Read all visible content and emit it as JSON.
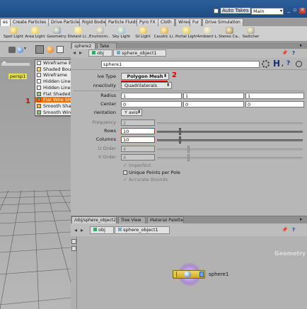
{
  "titlebar": {
    "auto_takes_label": "Auto Takes",
    "takes_select_value": "Main",
    "window_controls": [
      "minimize-icon",
      "maximize-icon",
      "close-icon"
    ]
  },
  "shelf": {
    "tabs": [
      "es",
      "Create Particles",
      "Drive Particles",
      "Rigid Bodies",
      "Particle Fluids",
      "Pyro FX",
      "Cloth",
      "Wires",
      "Fur",
      "Drive Simulation"
    ],
    "tools": [
      "Spot Light",
      "Area Light",
      "Geometry",
      "Distant Li...",
      "Environm...",
      "Sky Light",
      "GI Light",
      "Caustic Li...",
      "Portal Light",
      "Ambient L...",
      "Stereo Ca...",
      "Switcher"
    ]
  },
  "viewport": {
    "object_label": "persp1"
  },
  "shading_menu": {
    "items": [
      "Wireframe Bounding Box",
      "Shaded Bounding Box",
      "Wireframe",
      "Hidden Line Invisible",
      "Hidden Line Ghost",
      "Flat Shaded",
      "Flat Wire Shaded",
      "Smooth Shaded",
      "Smooth Wire Shaded"
    ],
    "highlighted": "Flat Wire Shaded"
  },
  "annotations": {
    "marker_one": "1",
    "marker_two": "2"
  },
  "param_pane": {
    "tabs": [
      "sphere2",
      "Take List"
    ],
    "path": {
      "network": "obj",
      "node": "sphere_object1"
    },
    "node_name": "sphere1",
    "params": {
      "type_label": "ive Type",
      "type_value": "Polygon Mesh",
      "connectivity_label": "nnectivity",
      "connectivity_value": "Quadrilaterals",
      "radius_label": "Radius",
      "radius_values": [
        "1",
        "1",
        "1"
      ],
      "center_label": "Center",
      "center_values": [
        "0",
        "0",
        "0"
      ],
      "orientation_label": "rientation",
      "orientation_value": "Y axis",
      "frequency_label": "Frequency",
      "frequency_value": "2",
      "rows_label": "Rows",
      "rows_value": "10",
      "columns_label": "Columns",
      "columns_value": "10",
      "u_order_label": "U Order",
      "u_order_value": "4",
      "v_order_label": "V Order",
      "v_order_value": "4",
      "imperfect_label": "Imperfect",
      "unique_points_label": "Unique Points per Pole",
      "accurate_bounds_label": "Accurate Bounds"
    }
  },
  "network_pane": {
    "tabs": [
      "/obj/sphere_object2",
      "Tree View",
      "Material Palette"
    ],
    "path": {
      "network": "obj",
      "node": "sphere_object1"
    },
    "context_label": "Geometry",
    "node": {
      "name": "sphere1"
    }
  },
  "colors": {
    "highlight": "#f06e00",
    "annotation_red": "#d20000"
  }
}
